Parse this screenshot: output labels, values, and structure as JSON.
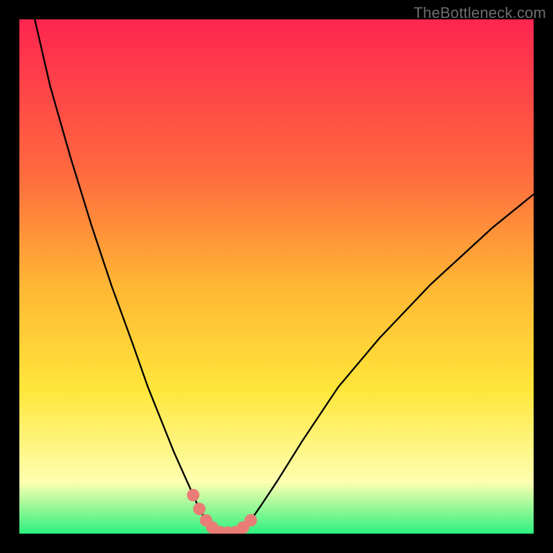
{
  "watermark": "TheBottleneck.com",
  "colors": {
    "frame": "#000000",
    "grad_top": "#fe2550",
    "grad_mid1": "#ff6a3e",
    "grad_mid2": "#ffb734",
    "grad_mid3": "#ffe63a",
    "grad_pale": "#feffb0",
    "grad_green": "#2cf17e",
    "curve": "#000000",
    "marker": "#e97c75"
  },
  "chart_data": {
    "type": "line",
    "title": "",
    "xlabel": "",
    "ylabel": "",
    "xlim": [
      0,
      100
    ],
    "ylim": [
      0,
      100
    ],
    "series": [
      {
        "name": "bottleneck-curve",
        "x": [
          3,
          6,
          10,
          14,
          18,
          22,
          25,
          28,
          30,
          32,
          33.8,
          35,
          36.3,
          37.5,
          39,
          40.5,
          42,
          43.5,
          45,
          47,
          50,
          55,
          62,
          70,
          80,
          92,
          100
        ],
        "y": [
          100,
          87,
          73,
          60,
          48,
          37,
          28.5,
          21,
          16,
          11.5,
          7.5,
          4.8,
          2.6,
          1.2,
          0.3,
          0.2,
          0.3,
          1.2,
          2.6,
          5.5,
          10,
          18,
          28.5,
          38,
          48.5,
          59.5,
          66
        ]
      }
    ],
    "markers": {
      "name": "highlight-dots",
      "x": [
        33.8,
        35.0,
        36.3,
        37.5,
        39.0,
        40.5,
        42.0,
        43.5,
        45.0
      ],
      "y": [
        7.5,
        4.8,
        2.6,
        1.2,
        0.3,
        0.2,
        0.3,
        1.2,
        2.6
      ]
    }
  }
}
